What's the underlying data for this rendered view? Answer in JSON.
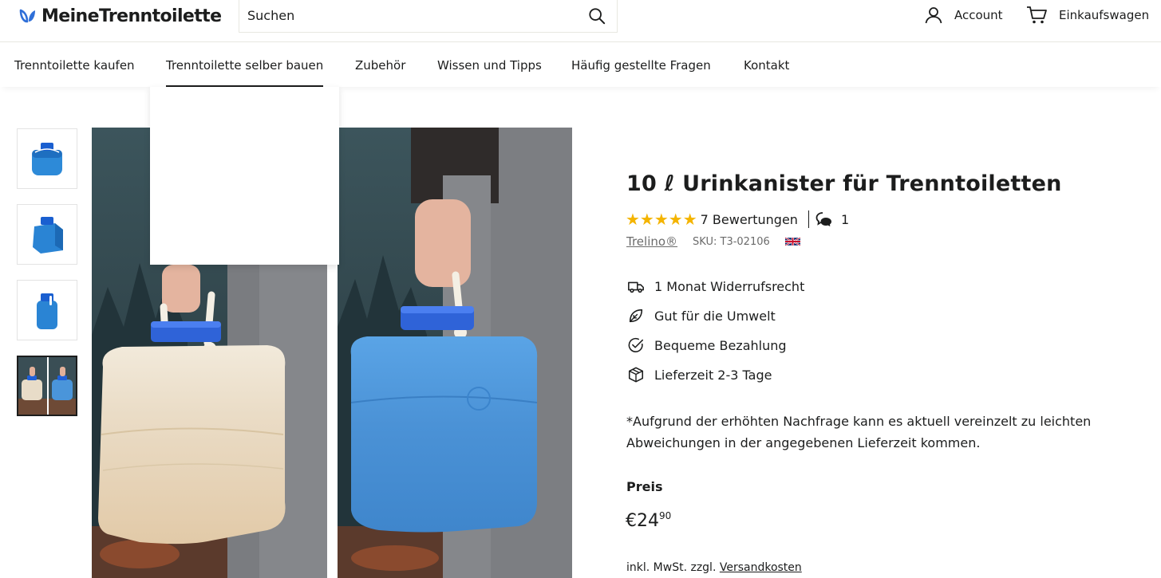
{
  "header": {
    "logo_text": "MeineTrenntoilette",
    "search_placeholder": "Suchen",
    "account_label": "Account",
    "cart_label": "Einkaufswagen"
  },
  "nav": {
    "items": [
      {
        "label": "Trenntoilette kaufen"
      },
      {
        "label": "Trenntoilette selber bauen",
        "active": true
      },
      {
        "label": "Zubehör"
      },
      {
        "label": "Wissen und Tipps"
      },
      {
        "label": "Häufig gestellte Fragen"
      },
      {
        "label": "Kontakt"
      }
    ]
  },
  "gallery": {
    "thumbnail_count": 4,
    "active_thumbnail": 4
  },
  "product": {
    "title": "10 ℓ Urinkanister für Trenntoiletten",
    "rating_stars": 5,
    "reviews_label": "7 Bewertungen",
    "questions_count": "1",
    "vendor": "Trelino®",
    "sku": "SKU: T3-02106",
    "features": [
      {
        "icon": "truck-icon",
        "label": "1 Monat Widerrufsrecht"
      },
      {
        "icon": "leaf-icon",
        "label": "Gut für die Umwelt"
      },
      {
        "icon": "check-badge-icon",
        "label": "Bequeme Bezahlung"
      },
      {
        "icon": "box-icon",
        "label": "Lieferzeit 2-3 Tage"
      }
    ],
    "notice": "*Aufgrund der erhöhten Nachfrage kann es aktuell vereinzelt zu leichten Abweichungen in der angegebenen Lieferzeit kommen.",
    "price_label": "Preis",
    "price_main": "€24",
    "price_cents": "90",
    "tax_text": "inkl. MwSt. zzgl.",
    "shipping_link": "Versandkosten"
  },
  "colors": {
    "text": "#1c1d1d",
    "star": "#f4b400",
    "logo_accent": "#2f6fd8",
    "border": "#e8e8e1"
  }
}
